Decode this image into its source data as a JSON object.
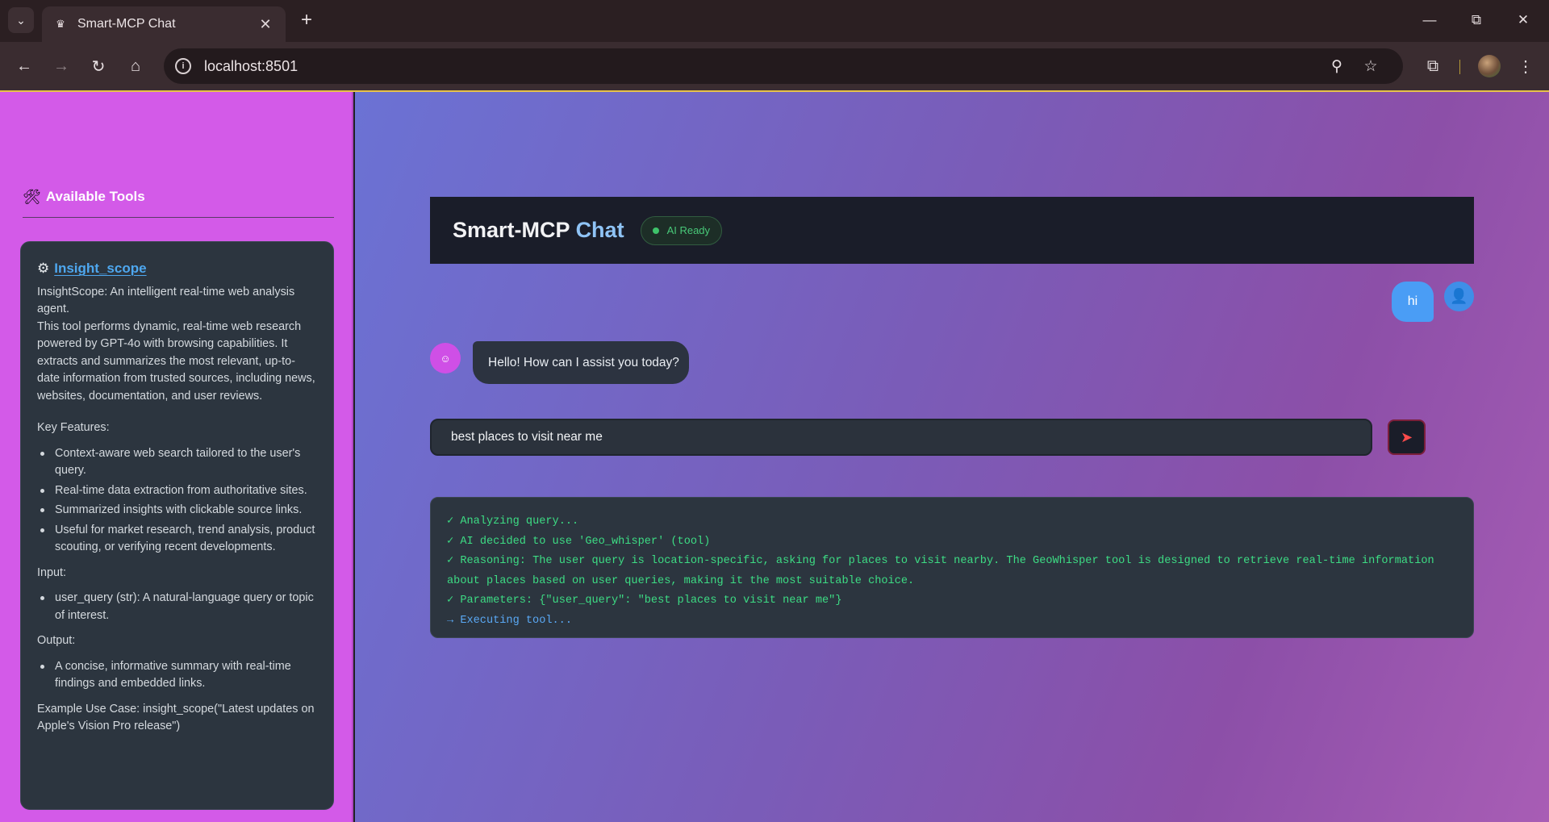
{
  "browser": {
    "tab_title": "Smart-MCP Chat",
    "url": "localhost:8501",
    "icons": {
      "tab_menu": "chevron-down-icon",
      "favicon": "crown-icon",
      "tab_close": "close-icon",
      "new_tab": "plus-icon",
      "minimize": "minimize-icon",
      "restore": "restore-icon",
      "close_window": "close-icon",
      "back": "back-arrow-icon",
      "forward": "forward-arrow-icon",
      "reload": "reload-icon",
      "home": "home-icon",
      "site_info": "info-icon",
      "zoom": "zoom-icon",
      "bookmark": "star-icon",
      "extensions": "puzzle-icon",
      "menu": "kebab-menu-icon"
    }
  },
  "sidebar": {
    "heading": "Available Tools",
    "tool": {
      "name": "Insight_scope",
      "intro1": "InsightScope: An intelligent real-time web analysis agent.",
      "intro2": "This tool performs dynamic, real-time web research powered by GPT-4o with browsing capabilities. It extracts and summarizes the most relevant, up-to-date information from trusted sources, including news, websites, documentation, and user reviews.",
      "features_label": "Key Features:",
      "features": [
        "Context-aware web search tailored to the user's query.",
        "Real-time data extraction from authoritative sites.",
        "Summarized insights with clickable source links.",
        "Useful for market research, trend analysis, product scouting, or verifying recent developments."
      ],
      "input_label": "Input:",
      "inputs": [
        "user_query (str): A natural-language query or topic of interest."
      ],
      "output_label": "Output:",
      "outputs": [
        "A concise, informative summary with real-time findings and embedded links."
      ],
      "example": "Example Use Case: insight_scope(\"Latest updates on Apple's Vision Pro release\")"
    }
  },
  "chat": {
    "title_part1": "Smart-MCP",
    "title_part2": "Chat",
    "status": "AI Ready",
    "status_color": "#3ec26a",
    "messages": [
      {
        "role": "user",
        "text": "hi"
      },
      {
        "role": "assistant",
        "text": "Hello! How can I assist you today?"
      }
    ],
    "input_value": "best places to visit near me",
    "send_icon": "send-arrow-icon",
    "log": [
      "✓ Analyzing query...",
      "✓ AI decided to use 'Geo_whisper' (tool)",
      "✓ Reasoning: The user query is location-specific, asking for places to visit nearby. The GeoWhisper tool is designed to retrieve real-time information about places based on user queries, making it the most suitable choice.",
      "✓ Parameters: {\"user_query\": \"best places to visit near me\"}",
      "→ Executing tool..."
    ]
  },
  "colors": {
    "sidebar_bg": "#d35ae8",
    "accent_blue": "#4ea7ef",
    "log_green": "#3ddc84",
    "send_red": "#ff4b4b"
  }
}
